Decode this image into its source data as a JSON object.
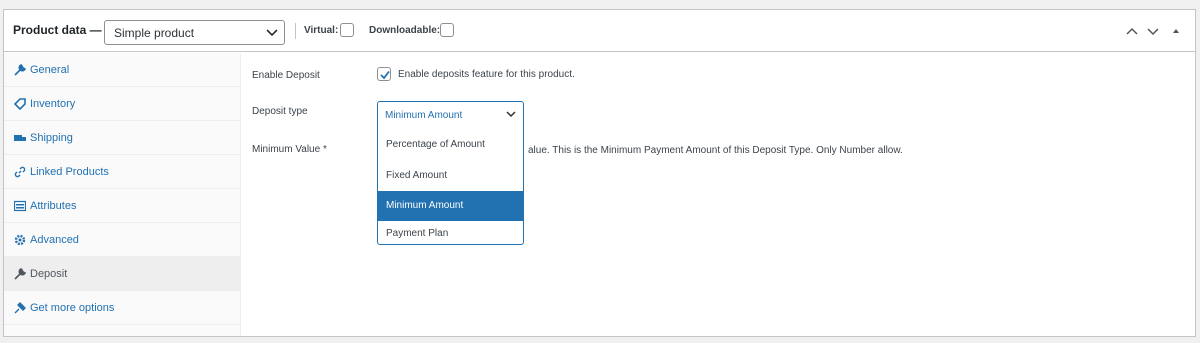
{
  "header": {
    "title": "Product data —",
    "product_type": "Simple product",
    "virtual_label": "Virtual:",
    "downloadable_label": "Downloadable:"
  },
  "sidebar": {
    "items": [
      {
        "label": "General",
        "icon": "wrench-icon"
      },
      {
        "label": "Inventory",
        "icon": "tag-icon"
      },
      {
        "label": "Shipping",
        "icon": "truck-icon"
      },
      {
        "label": "Linked Products",
        "icon": "link-icon"
      },
      {
        "label": "Attributes",
        "icon": "list-icon"
      },
      {
        "label": "Advanced",
        "icon": "gear-icon"
      },
      {
        "label": "Deposit",
        "icon": "wrench-icon",
        "active": true
      },
      {
        "label": "Get more options",
        "icon": "plugin-icon"
      }
    ]
  },
  "form": {
    "enable_label": "Enable Deposit",
    "enable_checkbox_text": "Enable deposits feature for this product.",
    "enable_checked": true,
    "type_label": "Deposit type",
    "type_value": "Minimum Amount",
    "min_label": "Minimum Value *",
    "min_desc": "alue. This is the Minimum Payment Amount of this Deposit Type. Only Number allow.",
    "dropdown_options": [
      "Percentage of Amount",
      "Fixed Amount",
      "Minimum Amount",
      "Payment Plan"
    ],
    "dropdown_selected": "Minimum Amount"
  },
  "colors": {
    "accent": "#2271b1",
    "border": "#c3c4c7"
  }
}
